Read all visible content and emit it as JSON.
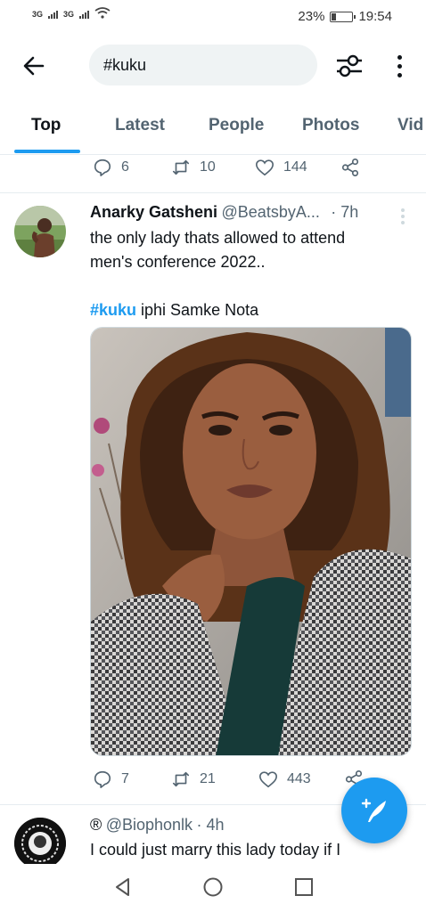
{
  "status_bar": {
    "network1": "3G",
    "network2": "3G",
    "battery": "23%",
    "time": "19:54"
  },
  "search": {
    "query": "#kuku"
  },
  "tabs": [
    {
      "label": "Top",
      "active": true
    },
    {
      "label": "Latest",
      "active": false
    },
    {
      "label": "People",
      "active": false
    },
    {
      "label": "Photos",
      "active": false
    },
    {
      "label": "Vid",
      "active": false
    }
  ],
  "prev_tweet": {
    "replies": "6",
    "retweets": "10",
    "likes": "144"
  },
  "tweet": {
    "name": "Anarky Gatsheni",
    "handle": "@BeatsbyA...",
    "time": "· 7h",
    "line1": "the only lady thats allowed to attend",
    "line2": "men's conference  2022..",
    "hashtag": "#kuku",
    "line3_rest": " iphi Samke Nota",
    "replies": "7",
    "retweets": "21",
    "likes": "443"
  },
  "next_tweet": {
    "name": "®",
    "handle": "@Biophonlk",
    "time": "· 4h",
    "text": "I could just marry this lady today if I"
  },
  "colors": {
    "accent": "#1d9bf0",
    "text": "#0f1419",
    "secondary": "#536471"
  }
}
